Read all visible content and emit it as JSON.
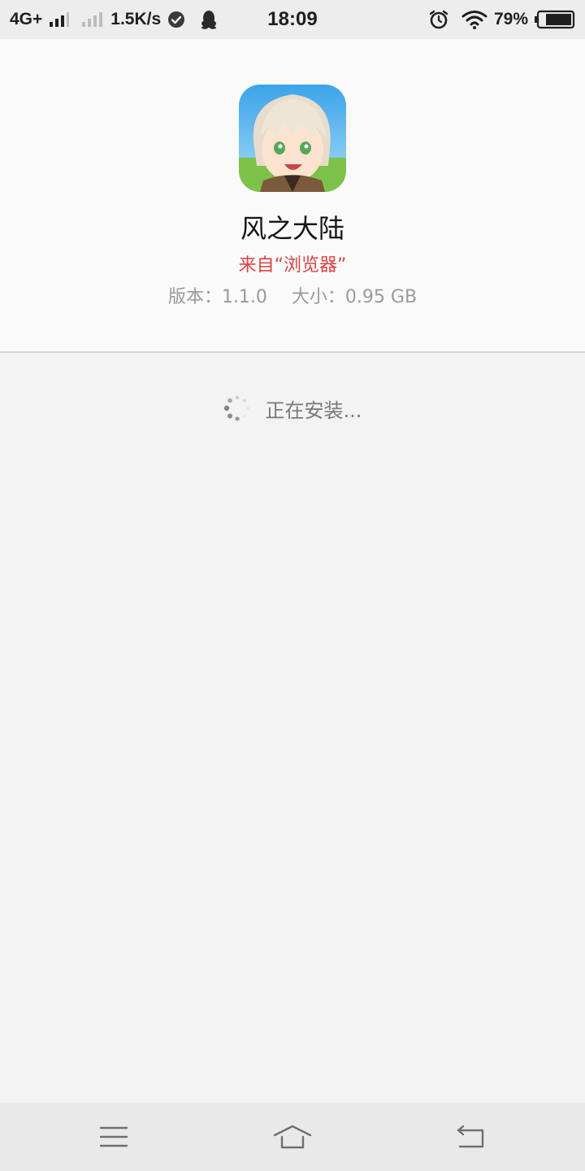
{
  "status_bar": {
    "network": "4G+",
    "speed": "1.5K/s",
    "time": "18:09",
    "battery": "79%"
  },
  "app": {
    "icon": "anime-boy-app-icon",
    "name": "风之大陆",
    "source": "来自“浏览器”",
    "version_label": "版本：1.1.0",
    "size_label": "大小：0.95 GB"
  },
  "install": {
    "status": "正在安装..."
  },
  "nav": {
    "menu_icon": "menu-icon",
    "home_icon": "home-icon",
    "back_icon": "back-icon"
  },
  "colors": {
    "accent_red": "#d94343",
    "background": "#f3f3f3",
    "card": "#fafafa"
  }
}
